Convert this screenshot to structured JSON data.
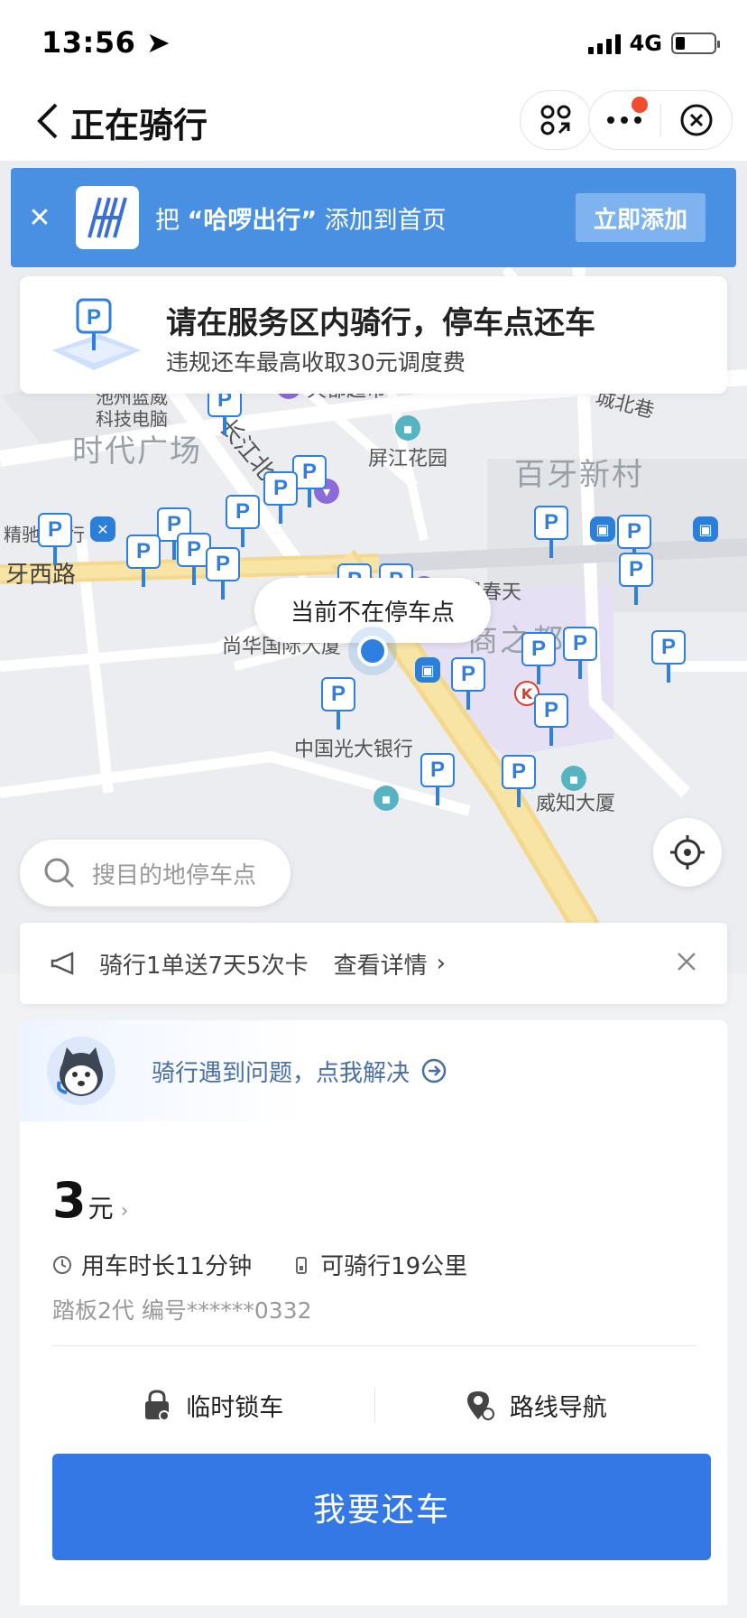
{
  "status_bar": {
    "time": "13:56",
    "network": "4G",
    "battery_level": 0.25
  },
  "title_bar": {
    "title": "正在骑行"
  },
  "add_banner": {
    "prefix": "把",
    "app_name": "“哈啰出行”",
    "suffix": "添加到首页",
    "add_label": "立即添加"
  },
  "notice": {
    "title": "请在服务区内骑行，停车点还车",
    "subtitle": "违规还车最高收取30元调度费"
  },
  "map": {
    "labels": {
      "tiandu": "天都超市",
      "chizhou": "池州蓝威",
      "chizhou2": "科技电脑",
      "chengbei": "城北巷",
      "shidai": "时代广场",
      "changjiang": "长江北",
      "pingjiang": "屏江花园",
      "baiya": "百牙新村",
      "jingchi": "精驰",
      "hang": "行",
      "yaxilu": "牙西路",
      "langman": "浪漫春天",
      "shangzhidu": "商之都",
      "shanghua": "尚华国际大厦",
      "guangda": "中国光大银行",
      "weizhi": "威知大厦"
    },
    "current_tip": "当前不在停车点",
    "search_placeholder": "搜目的地停车点"
  },
  "promo": {
    "text": "骑行1单送7天5次卡",
    "detail": "查看详情",
    "chevron": "›"
  },
  "help": {
    "text": "骑行遇到问题，点我解决"
  },
  "ride": {
    "price": "3",
    "unit": "元",
    "arrow": "›",
    "duration": "用车时长11分钟",
    "range": "可骑行19公里",
    "model": "踏板2代  编号******0332",
    "lock_label": "临时锁车",
    "nav_label": "路线导航",
    "return_label": "我要还车"
  },
  "colors": {
    "brand": "#3478e6",
    "banner": "#4a90e2",
    "parking": "#2f7fe0"
  }
}
